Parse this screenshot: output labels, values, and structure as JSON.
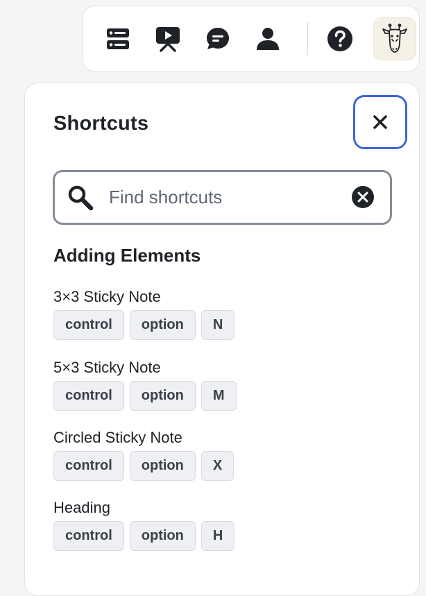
{
  "toolbar": {
    "items": [
      {
        "name": "list-icon"
      },
      {
        "name": "presentation-icon"
      },
      {
        "name": "chat-bubble-icon"
      },
      {
        "name": "person-icon"
      },
      {
        "name": "help-icon"
      },
      {
        "name": "giraffe-avatar"
      }
    ]
  },
  "panel": {
    "title": "Shortcuts",
    "search_placeholder": "Find shortcuts",
    "search_value": ""
  },
  "section": {
    "title": "Adding Elements",
    "shortcuts": [
      {
        "label": "3×3 Sticky Note",
        "keys": [
          "control",
          "option",
          "N"
        ]
      },
      {
        "label": "5×3 Sticky Note",
        "keys": [
          "control",
          "option",
          "M"
        ]
      },
      {
        "label": "Circled Sticky Note",
        "keys": [
          "control",
          "option",
          "X"
        ]
      },
      {
        "label": "Heading",
        "keys": [
          "control",
          "option",
          "H"
        ]
      }
    ]
  },
  "colors": {
    "focus_border": "#3d64d8",
    "key_bg": "#eef0f3",
    "avatar_bg": "#f6f1e6"
  }
}
